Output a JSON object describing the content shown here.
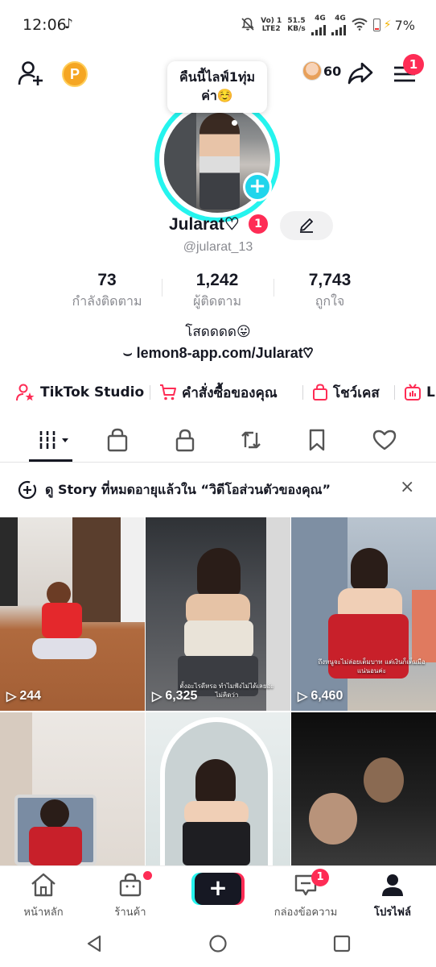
{
  "status_bar": {
    "time": "12:06",
    "note_icon": "tiktok-note-icon",
    "volte_top": "Vo) 1",
    "volte_bottom": "LTE2",
    "speed_top": "51.5",
    "speed_bottom": "KB/s",
    "net1": "4G",
    "net2": "4G",
    "battery": "7%"
  },
  "header": {
    "add_friend_icon": "add-user-icon",
    "coin_label": "P",
    "bubble_line1": "คืนนี้ไลฟ์1ทุ่ม",
    "bubble_line2": "ค่า☺️",
    "profile_views": "60",
    "share_icon": "share-arrow-icon",
    "menu_badge": "1"
  },
  "profile": {
    "name": "Jularat♡",
    "name_badge": "1",
    "handle": "@jularat_13",
    "stats": [
      {
        "value": "73",
        "label": "กำลังติดตาม"
      },
      {
        "value": "1,242",
        "label": "ผู้ติดตาม"
      },
      {
        "value": "7,743",
        "label": "ถูกใจ"
      }
    ],
    "bio": "โสดดดด😛",
    "link": "lemon8-app.com/Jularat♡"
  },
  "shortcuts": [
    {
      "label": "TikTok Studio",
      "icon": "studio-icon"
    },
    {
      "label": "คำสั่งซื้อของคุณ",
      "icon": "cart-icon"
    },
    {
      "label": "โชว์เคส",
      "icon": "bag-icon"
    },
    {
      "label": "LI",
      "icon": "live-icon"
    }
  ],
  "tabs": [
    {
      "name": "videos-grid",
      "icon": "grid-icon"
    },
    {
      "name": "shop",
      "icon": "shopping-bag-icon"
    },
    {
      "name": "private",
      "icon": "lock-icon"
    },
    {
      "name": "reposts",
      "icon": "repost-icon"
    },
    {
      "name": "favorites",
      "icon": "bookmark-icon"
    },
    {
      "name": "liked",
      "icon": "heart-icon"
    }
  ],
  "story_bar": {
    "text": "ดู Story ที่หมดอายุแล้วใน “วิดีโอส่วนตัวของคุณ”",
    "close": "×"
  },
  "videos": [
    {
      "views": "244",
      "caption": ""
    },
    {
      "views": "6,325",
      "caption": "ตั้งอะไรดีหรอ ทำไมฟังไม่ได้เลยอ่ะ ไม่คิดว่า"
    },
    {
      "views": "6,460",
      "caption": "ถึงหนูจะไม่ล่อยเต็มบาท แต่เงินก็เต็มมือแน่นอนค่ะ"
    },
    {
      "views": "",
      "caption": ""
    },
    {
      "views": "",
      "caption": ""
    },
    {
      "views": "",
      "caption": ""
    }
  ],
  "bottom_nav": [
    {
      "label": "หน้าหลัก",
      "icon": "home-icon"
    },
    {
      "label": "ร้านค้า",
      "icon": "shop-icon"
    },
    {
      "label": "",
      "icon": "plus-icon"
    },
    {
      "label": "กล่องข้อความ",
      "icon": "inbox-icon",
      "badge": "1"
    },
    {
      "label": "โปรไฟล์",
      "icon": "profile-icon"
    }
  ],
  "colors": {
    "accent": "#fe2c55",
    "cyan": "#25f4ee",
    "text": "#161823",
    "muted": "#8a8b91"
  }
}
